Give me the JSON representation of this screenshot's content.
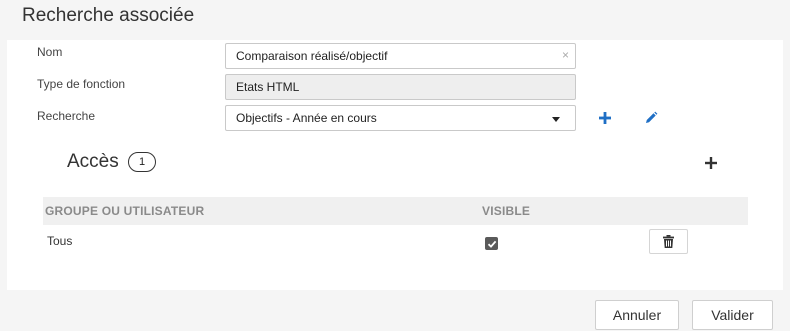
{
  "dialog": {
    "title": "Recherche associée"
  },
  "form": {
    "nom": {
      "label": "Nom",
      "value": "Comparaison réalisé/objectif",
      "clear_glyph": "×"
    },
    "type_fonction": {
      "label": "Type de fonction",
      "value": "Etats HTML"
    },
    "recherche": {
      "label": "Recherche",
      "value": "Objectifs - Année en cours"
    }
  },
  "acces": {
    "title": "Accès",
    "count": "1",
    "columns": [
      "GROUPE OU UTILISATEUR",
      "VISIBLE"
    ],
    "rows": [
      {
        "group": "Tous",
        "visible": true
      }
    ]
  },
  "footer": {
    "cancel_label": "Annuler",
    "validate_label": "Valider"
  },
  "colors": {
    "accent_blue": "#1f6fc5",
    "dark": "#333333"
  },
  "icons": [
    "plus-icon",
    "pencil-icon",
    "trash-icon",
    "check-icon",
    "caret-down-icon",
    "clear-icon"
  ]
}
